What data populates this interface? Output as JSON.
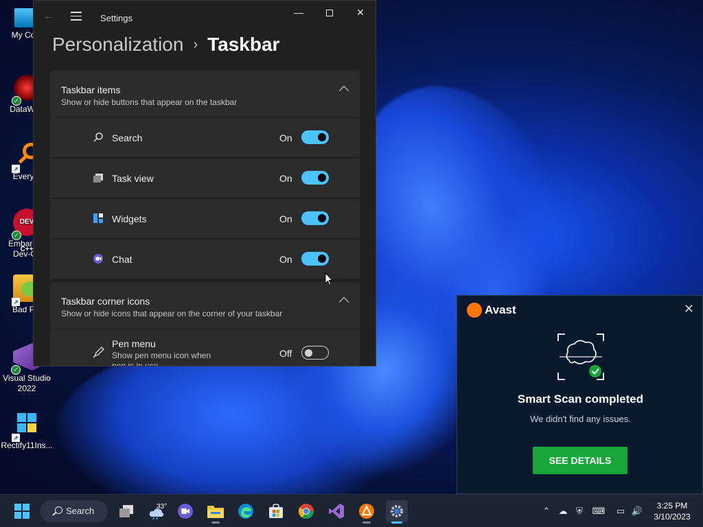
{
  "desktop": {
    "icons": [
      {
        "label": "My Com",
        "icon": "computer-icon"
      },
      {
        "label": "DataWag",
        "icon": "datawag-app-icon"
      },
      {
        "label": "Everyth",
        "icon": "everything-search-icon"
      },
      {
        "label": "Embarca Dev-C",
        "icon": "dev-cpp-icon",
        "badge_text": "DEV C++"
      },
      {
        "label": "Bad Pig",
        "icon": "bad-piggies-icon"
      },
      {
        "label": "Visual Studio 2022",
        "icon": "visual-studio-icon"
      },
      {
        "label": "Rectify11Ins...",
        "icon": "rectify11-installer-icon"
      }
    ]
  },
  "settings": {
    "window_title": "Settings",
    "breadcrumb": {
      "parent": "Personalization",
      "separator": "›",
      "current": "Taskbar"
    },
    "sections": [
      {
        "title": "Taskbar items",
        "subtitle": "Show or hide buttons that appear on the taskbar",
        "expanded": true,
        "items": [
          {
            "label": "Search",
            "state": "On",
            "on": true,
            "icon": "search-icon"
          },
          {
            "label": "Task view",
            "state": "On",
            "on": true,
            "icon": "task-view-icon"
          },
          {
            "label": "Widgets",
            "state": "On",
            "on": true,
            "icon": "widgets-icon"
          },
          {
            "label": "Chat",
            "state": "On",
            "on": true,
            "icon": "chat-icon"
          }
        ]
      },
      {
        "title": "Taskbar corner icons",
        "subtitle": "Show or hide icons that appear on the corner of your taskbar",
        "expanded": true,
        "items": [
          {
            "label": "Pen menu",
            "sublabel": "Show pen menu icon when pen is in use",
            "state": "Off",
            "on": false,
            "icon": "pen-icon"
          }
        ]
      }
    ],
    "colors": {
      "accent": "#4cc2ff",
      "panel": "#2b2b2b",
      "background": "#202020"
    }
  },
  "avast": {
    "brand": "Avast",
    "title": "Smart Scan completed",
    "message": "We didn't find any issues.",
    "button": "SEE DETAILS",
    "colors": {
      "brand": "#ff7800",
      "button": "#18a53a",
      "background": "#0a1a2e"
    }
  },
  "taskbar": {
    "search_label": "Search",
    "weather_temp": "33°",
    "apps": [
      {
        "name": "start-button-icon"
      },
      {
        "name": "task-view-icon"
      },
      {
        "name": "weather-widget-icon"
      },
      {
        "name": "chat-icon"
      },
      {
        "name": "file-explorer-icon"
      },
      {
        "name": "edge-icon"
      },
      {
        "name": "store-icon"
      },
      {
        "name": "chrome-icon"
      },
      {
        "name": "visual-studio-icon"
      },
      {
        "name": "avast-icon"
      },
      {
        "name": "settings-icon"
      }
    ],
    "clock": {
      "time": "3:25 PM",
      "date": "3/10/2023"
    }
  }
}
